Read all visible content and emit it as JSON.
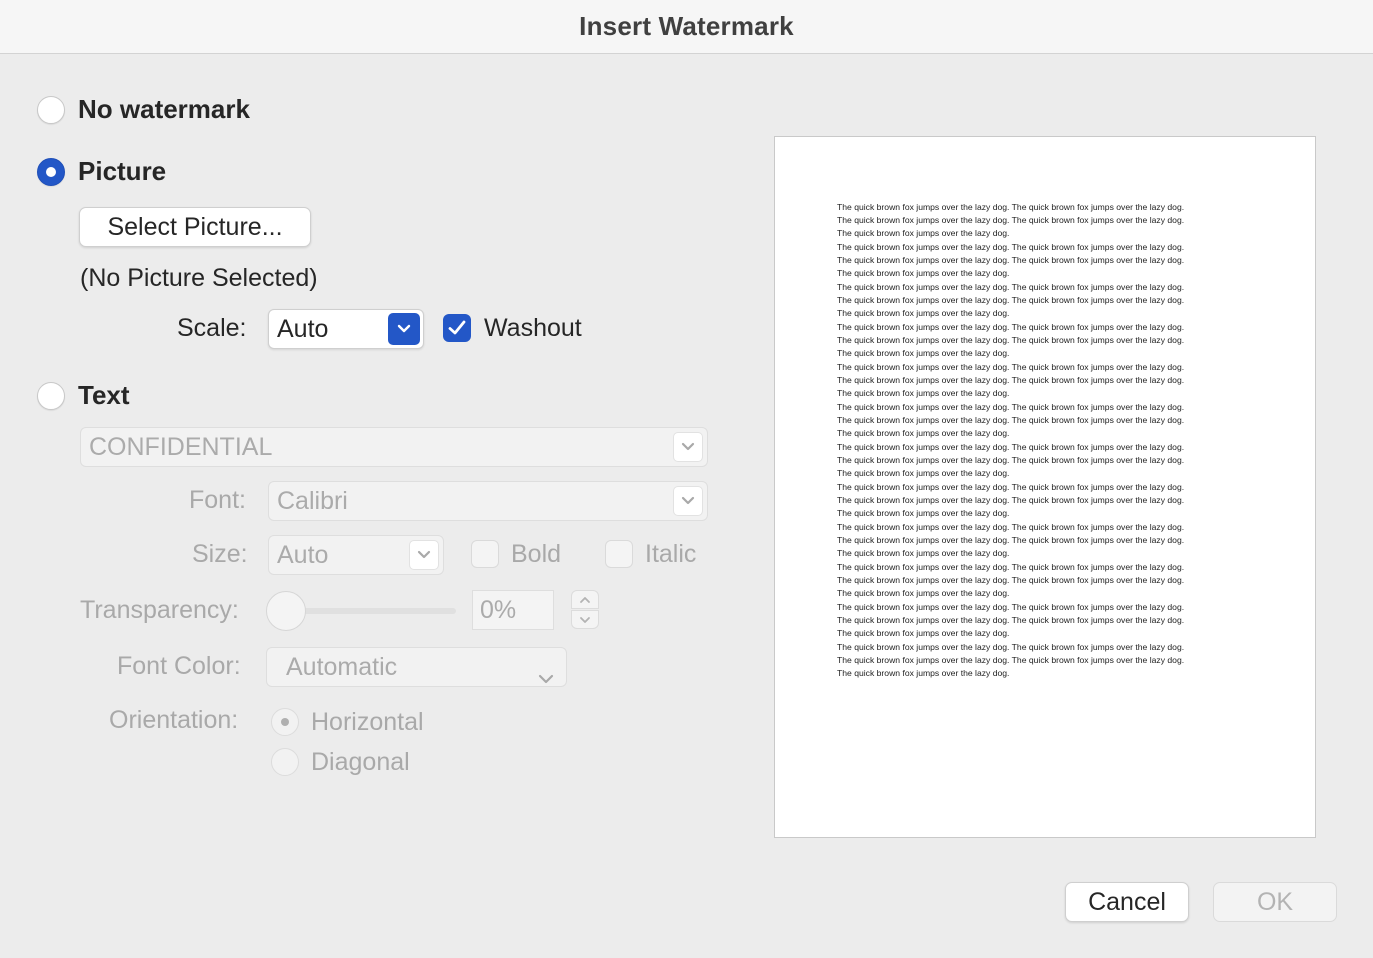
{
  "window": {
    "title": "Insert Watermark"
  },
  "options": {
    "no_watermark": "No watermark",
    "picture": "Picture",
    "text": "Text"
  },
  "picture": {
    "select_button": "Select Picture...",
    "status": "(No Picture Selected)",
    "scale_label": "Scale:",
    "scale_value": "Auto",
    "washout_label": "Washout",
    "washout_checked": true
  },
  "text": {
    "text_value": "CONFIDENTIAL",
    "font_label": "Font:",
    "font_value": "Calibri",
    "size_label": "Size:",
    "size_value": "Auto",
    "bold_label": "Bold",
    "italic_label": "Italic",
    "transparency_label": "Transparency:",
    "transparency_value": "0%",
    "font_color_label": "Font Color:",
    "font_color_value": "Automatic",
    "orientation_label": "Orientation:",
    "horizontal_label": "Horizontal",
    "diagonal_label": "Diagonal"
  },
  "preview": {
    "sentence": "The quick brown fox jumps over the lazy dog.",
    "paragraph_count": 12
  },
  "buttons": {
    "cancel": "Cancel",
    "ok": "OK"
  },
  "colors": {
    "accent": "#2357c7",
    "background": "#ececec"
  }
}
